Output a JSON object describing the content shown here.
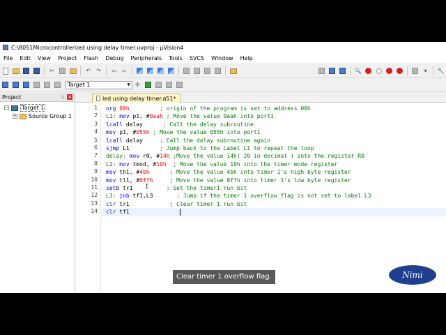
{
  "window": {
    "title": "C:\\8051Microcontroller\\led using delay timer.uvproj - µVision4"
  },
  "menu": [
    "File",
    "Edit",
    "View",
    "Project",
    "Flash",
    "Debug",
    "Peripherals",
    "Tools",
    "SVCS",
    "Window",
    "Help"
  ],
  "toolbar": {
    "target_select_value": "Target 1"
  },
  "project_panel": {
    "title": "Project",
    "tree": [
      {
        "label": "Target 1",
        "expander": "−"
      },
      {
        "label": "Source Group 1",
        "expander": "+"
      }
    ]
  },
  "editor": {
    "tab_label": "led using delay timer.a51*",
    "line_numbers": [
      "1",
      "2",
      "3",
      "4",
      "5",
      "6",
      "7",
      "8",
      "9",
      "10",
      "11",
      "12",
      "13",
      "14"
    ],
    "lines": [
      [
        [
          "kw",
          "org "
        ],
        [
          "num",
          "00h"
        ],
        [
          "txt",
          "         "
        ],
        [
          "cmt",
          "; origin of the program is set to address 00h"
        ]
      ],
      [
        [
          "lbl",
          "L1: "
        ],
        [
          "kw",
          "mov "
        ],
        [
          "txt",
          "p1, #"
        ],
        [
          "num",
          "0aah"
        ],
        [
          "txt",
          " "
        ],
        [
          "cmt",
          "; Move the value 0aah into port1"
        ]
      ],
      [
        [
          "kw",
          "lcall "
        ],
        [
          "txt",
          "delay      "
        ],
        [
          "cmt",
          "; Call the delay subroutine"
        ]
      ],
      [
        [
          "kw",
          "mov "
        ],
        [
          "txt",
          "p1, #"
        ],
        [
          "num",
          "055h"
        ],
        [
          "txt",
          " "
        ],
        [
          "cmt",
          "; Move the value 055h into port1"
        ]
      ],
      [
        [
          "kw",
          "lcall "
        ],
        [
          "txt",
          "delay     "
        ],
        [
          "cmt",
          "; Call the delay subroutine again"
        ]
      ],
      [
        [
          "kw",
          "sjmp "
        ],
        [
          "txt",
          "L1         "
        ],
        [
          "cmt",
          "; Jump back to the Label L1 to repeat the loop"
        ]
      ],
      [
        [
          "lbl",
          "delay: "
        ],
        [
          "kw",
          "mov "
        ],
        [
          "txt",
          "r0, #"
        ],
        [
          "num",
          "14h"
        ],
        [
          "txt",
          " "
        ],
        [
          "cmt",
          ";Move the value 14h( 20 in decimal ) into the register R0"
        ]
      ],
      [
        [
          "lbl",
          "L2: "
        ],
        [
          "kw",
          "mov "
        ],
        [
          "txt",
          "tmod, #"
        ],
        [
          "num",
          "10h"
        ],
        [
          "txt",
          "  "
        ],
        [
          "cmt",
          "; Move the value 10h into the timer mode register"
        ]
      ],
      [
        [
          "kw",
          "mov "
        ],
        [
          "txt",
          "th1, #"
        ],
        [
          "num",
          "4bh"
        ],
        [
          "txt",
          "      "
        ],
        [
          "cmt",
          "; Move the value 4bh into timer 1's high byte register"
        ]
      ],
      [
        [
          "kw",
          "mov "
        ],
        [
          "txt",
          "tl1, #"
        ],
        [
          "num",
          "0ffh"
        ],
        [
          "txt",
          "     "
        ],
        [
          "cmt",
          "; Move the value 0ffh into timer 1's low byte register"
        ]
      ],
      [
        [
          "kw",
          "setb "
        ],
        [
          "txt",
          "tr1          "
        ],
        [
          "cmt",
          "; Set the timer1 run bit"
        ]
      ],
      [
        [
          "lbl",
          "L3: "
        ],
        [
          "kw",
          "jnb "
        ],
        [
          "txt",
          "tf1,L3       "
        ],
        [
          "cmt",
          "; Jump if the timer 1 overflow flag is not set to label L3"
        ]
      ],
      [
        [
          "kw",
          "clr "
        ],
        [
          "txt",
          "tr1            "
        ],
        [
          "cmt",
          "; Clear timer 1 run bit"
        ]
      ],
      [
        [
          "kw",
          "clr "
        ],
        [
          "txt",
          "tf1"
        ]
      ]
    ]
  },
  "caption": "Clear timer 1 overflow flag.",
  "logo": {
    "text": "Nimi"
  }
}
